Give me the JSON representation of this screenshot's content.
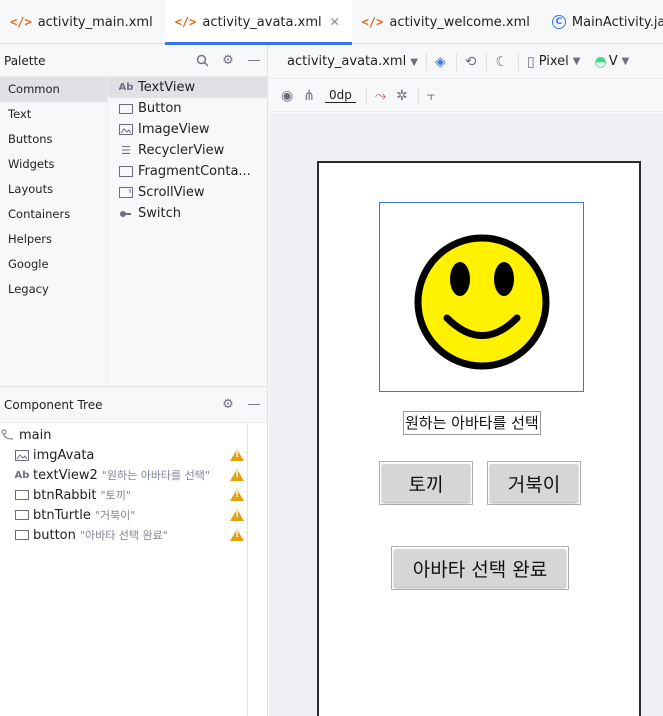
{
  "tabs": [
    {
      "label": "activity_main.xml",
      "icon": "xml-file-icon",
      "active": false
    },
    {
      "label": "activity_avata.xml",
      "icon": "xml-file-icon",
      "active": true
    },
    {
      "label": "activity_welcome.xml",
      "icon": "xml-file-icon",
      "active": false
    },
    {
      "label": "MainActivity.java",
      "icon": "java-class-icon",
      "active": false
    }
  ],
  "palette": {
    "title": "Palette",
    "categories": [
      "Common",
      "Text",
      "Buttons",
      "Widgets",
      "Layouts",
      "Containers",
      "Helpers",
      "Google",
      "Legacy"
    ],
    "selected_category": "Common",
    "items": [
      {
        "label": "TextView",
        "icon": "Ab"
      },
      {
        "label": "Button",
        "icon": "button-icon"
      },
      {
        "label": "ImageView",
        "icon": "image-icon"
      },
      {
        "label": "RecyclerView",
        "icon": "list-icon"
      },
      {
        "label": "FragmentConta...",
        "icon": "fragment-icon"
      },
      {
        "label": "ScrollView",
        "icon": "scroll-icon"
      },
      {
        "label": "Switch",
        "icon": "switch-icon"
      }
    ]
  },
  "component_tree": {
    "title": "Component Tree",
    "root": "main",
    "nodes": [
      {
        "label": "imgAvata",
        "sub": "",
        "icon": "image-icon"
      },
      {
        "label": "textView2",
        "sub": "\"원하는 아바타를 선택\"",
        "icon": "Ab"
      },
      {
        "label": "btnRabbit",
        "sub": "\"토끼\"",
        "icon": "button-icon"
      },
      {
        "label": "btnTurtle",
        "sub": "\"거북이\"",
        "icon": "button-icon"
      },
      {
        "label": "button",
        "sub": "\"아바타 선택 완료\"",
        "icon": "button-icon"
      }
    ]
  },
  "editor": {
    "file": "activity_avata.xml",
    "device": "Pixel",
    "api": "V",
    "margin": "0dp"
  },
  "preview": {
    "caption": "원하는 아바타를 선택",
    "btn_rabbit": "토끼",
    "btn_turtle": "거북이",
    "btn_done": "아바타 선택 완료"
  },
  "colors": {
    "accent": "#3574f0",
    "warning": "#e0a30e",
    "smiley_face": "#fff200"
  }
}
